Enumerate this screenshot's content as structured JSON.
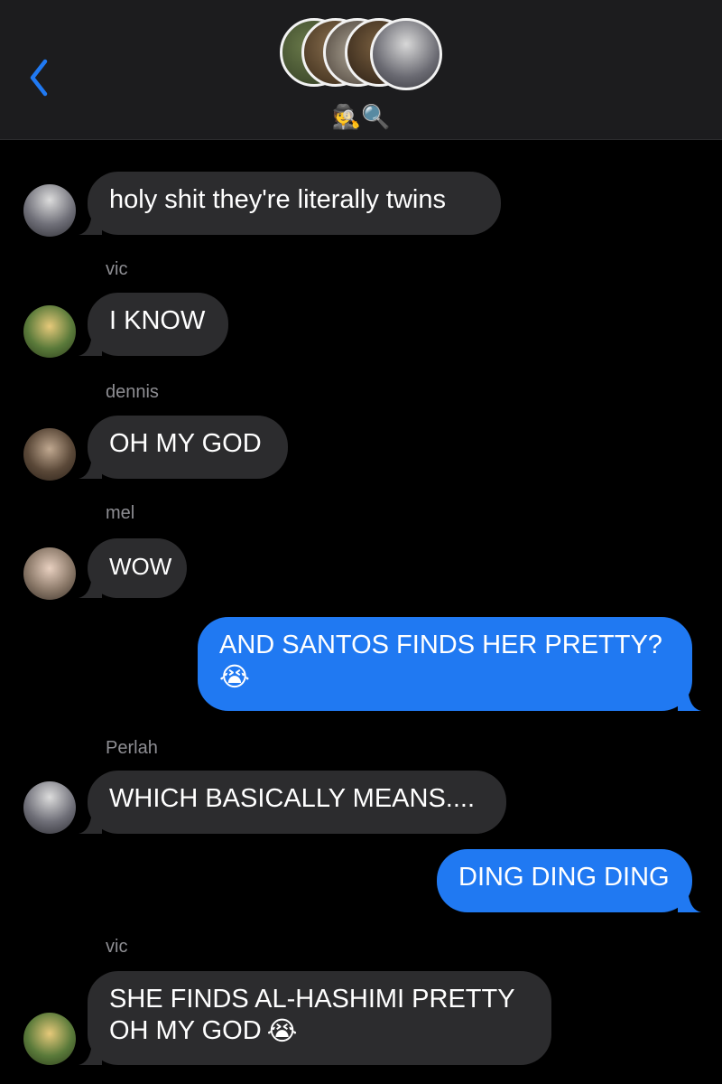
{
  "header": {
    "group_name": "🕵️🔍",
    "back_icon": "chevron-left-icon",
    "accent_color": "#2079f2"
  },
  "messages": [
    {
      "sender": "",
      "text": "holy shit they're literally twins",
      "direction": "incoming"
    },
    {
      "sender": "vic",
      "text": "I KNOW",
      "direction": "incoming"
    },
    {
      "sender": "dennis",
      "text": "OH MY GOD",
      "direction": "incoming"
    },
    {
      "sender": "mel",
      "text": "WOW",
      "direction": "incoming"
    },
    {
      "sender": "",
      "line1": "AND SANTOS FINDS HER PRETTY?",
      "line2": "",
      "emoji": "😭",
      "direction": "outgoing"
    },
    {
      "sender": "Perlah",
      "text": "WHICH BASICALLY MEANS....",
      "direction": "incoming"
    },
    {
      "sender": "",
      "text": "DING DING DING",
      "direction": "outgoing"
    },
    {
      "sender": "vic",
      "line1": "SHE FINDS AL-HASHIMI PRETTY",
      "line2": "OH MY GOD",
      "emoji": "😭",
      "direction": "incoming"
    }
  ],
  "colors": {
    "incoming_bubble": "#2c2c2e",
    "outgoing_bubble": "#2079f2",
    "sender_label": "#8e8e93"
  }
}
